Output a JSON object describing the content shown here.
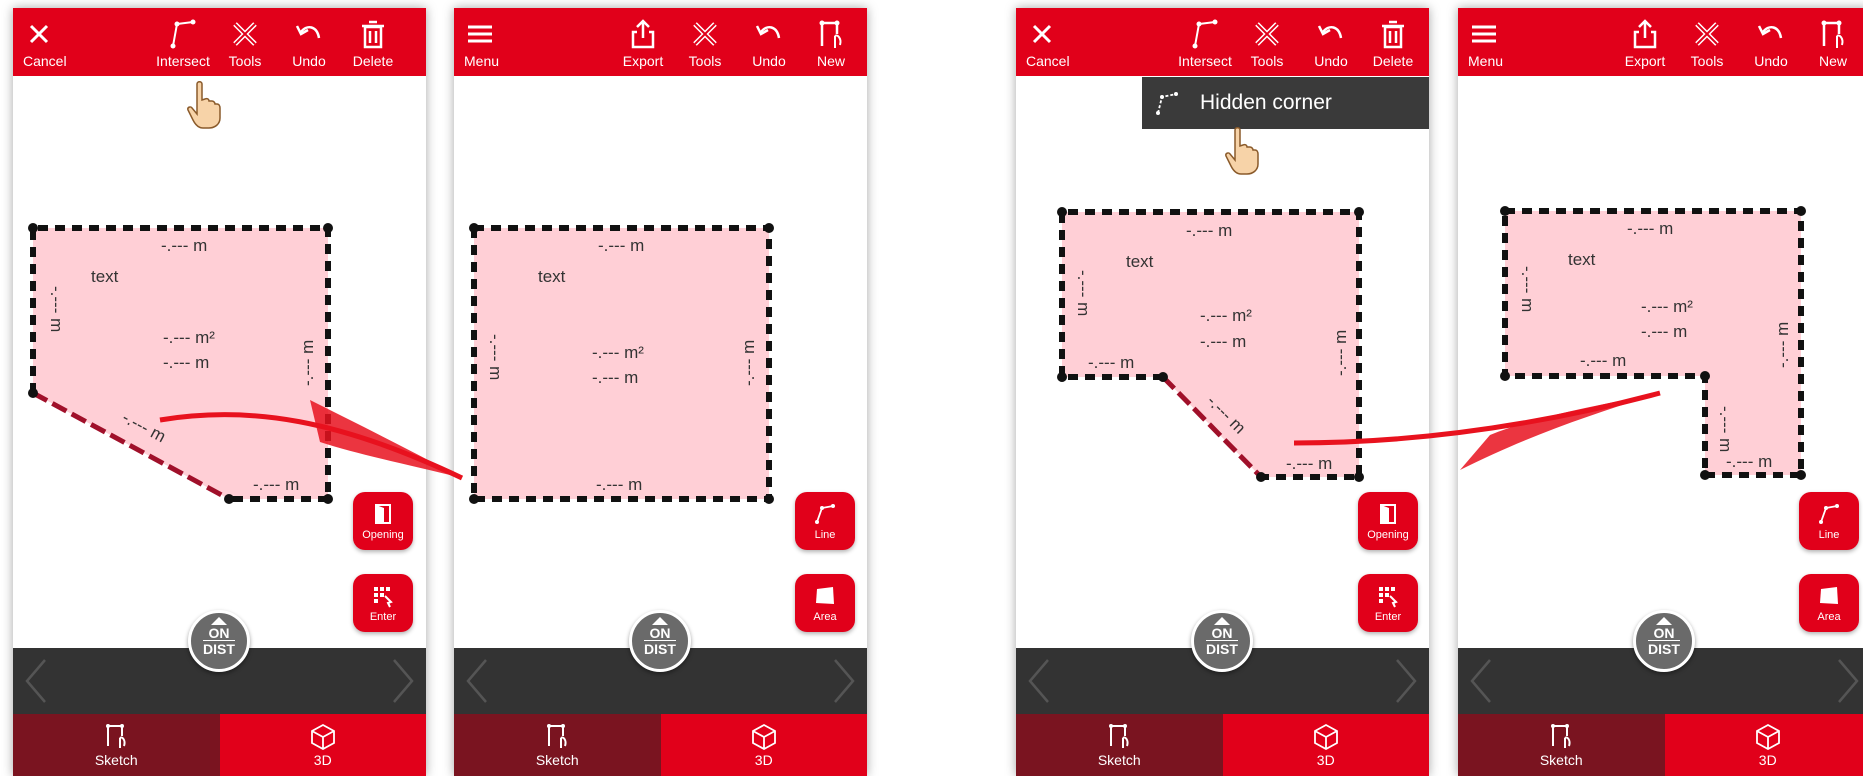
{
  "screens": [
    {
      "top_left": {
        "label": "Cancel",
        "icon": "close-icon"
      },
      "top_items": [
        {
          "label": "Intersect",
          "icon": "intersect-icon"
        },
        {
          "label": "Tools",
          "icon": "tools-icon"
        },
        {
          "label": "Undo",
          "icon": "undo-icon"
        },
        {
          "label": "Delete",
          "icon": "trash-icon"
        }
      ],
      "fabs": [
        {
          "label": "Opening",
          "icon": "door-icon"
        },
        {
          "label": "Enter",
          "icon": "keypad-icon"
        }
      ],
      "labels": {
        "text": "text",
        "area": "-.--- m²",
        "perimeter": "-.--- m",
        "dim": "-.--- m"
      }
    },
    {
      "top_left": {
        "label": "Menu",
        "icon": "menu-icon"
      },
      "top_items": [
        {
          "label": "Export",
          "icon": "export-icon"
        },
        {
          "label": "Tools",
          "icon": "tools-icon"
        },
        {
          "label": "Undo",
          "icon": "undo-icon"
        },
        {
          "label": "New",
          "icon": "new-sketch-icon"
        }
      ],
      "fabs": [
        {
          "label": "Line",
          "icon": "line-icon"
        },
        {
          "label": "Area",
          "icon": "area-icon"
        }
      ],
      "labels": {
        "text": "text",
        "area": "-.--- m²",
        "perimeter": "-.--- m",
        "dim": "-.--- m"
      }
    },
    {
      "top_left": {
        "label": "Cancel",
        "icon": "close-icon"
      },
      "top_items": [
        {
          "label": "Intersect",
          "icon": "intersect-icon"
        },
        {
          "label": "Tools",
          "icon": "tools-icon"
        },
        {
          "label": "Undo",
          "icon": "undo-icon"
        },
        {
          "label": "Delete",
          "icon": "trash-icon"
        }
      ],
      "fabs": [
        {
          "label": "Opening",
          "icon": "door-icon"
        },
        {
          "label": "Enter",
          "icon": "keypad-icon"
        }
      ],
      "popup": {
        "label": "Hidden corner",
        "icon": "hidden-corner-icon"
      },
      "labels": {
        "text": "text",
        "area": "-.--- m²",
        "perimeter": "-.--- m",
        "dim": "-.--- m"
      }
    },
    {
      "top_left": {
        "label": "Menu",
        "icon": "menu-icon"
      },
      "top_items": [
        {
          "label": "Export",
          "icon": "export-icon"
        },
        {
          "label": "Tools",
          "icon": "tools-icon"
        },
        {
          "label": "Undo",
          "icon": "undo-icon"
        },
        {
          "label": "New",
          "icon": "new-sketch-icon"
        }
      ],
      "fabs": [
        {
          "label": "Line",
          "icon": "line-icon"
        },
        {
          "label": "Area",
          "icon": "area-icon"
        }
      ],
      "labels": {
        "text": "text",
        "area": "-.--- m²",
        "perimeter": "-.--- m",
        "dim": "-.--- m"
      }
    }
  ],
  "ondist": {
    "on": "ON",
    "dist": "DIST"
  },
  "bottom_tabs": [
    {
      "label": "Sketch",
      "icon": "sketch-icon"
    },
    {
      "label": "3D",
      "icon": "cube-icon"
    }
  ],
  "colors": {
    "brand_red": "#e1001a",
    "dark_red": "#7a1420",
    "dark_bar": "#333333",
    "shape_fill": "#ffcfd6",
    "popup_bg": "#3a3a3a"
  }
}
